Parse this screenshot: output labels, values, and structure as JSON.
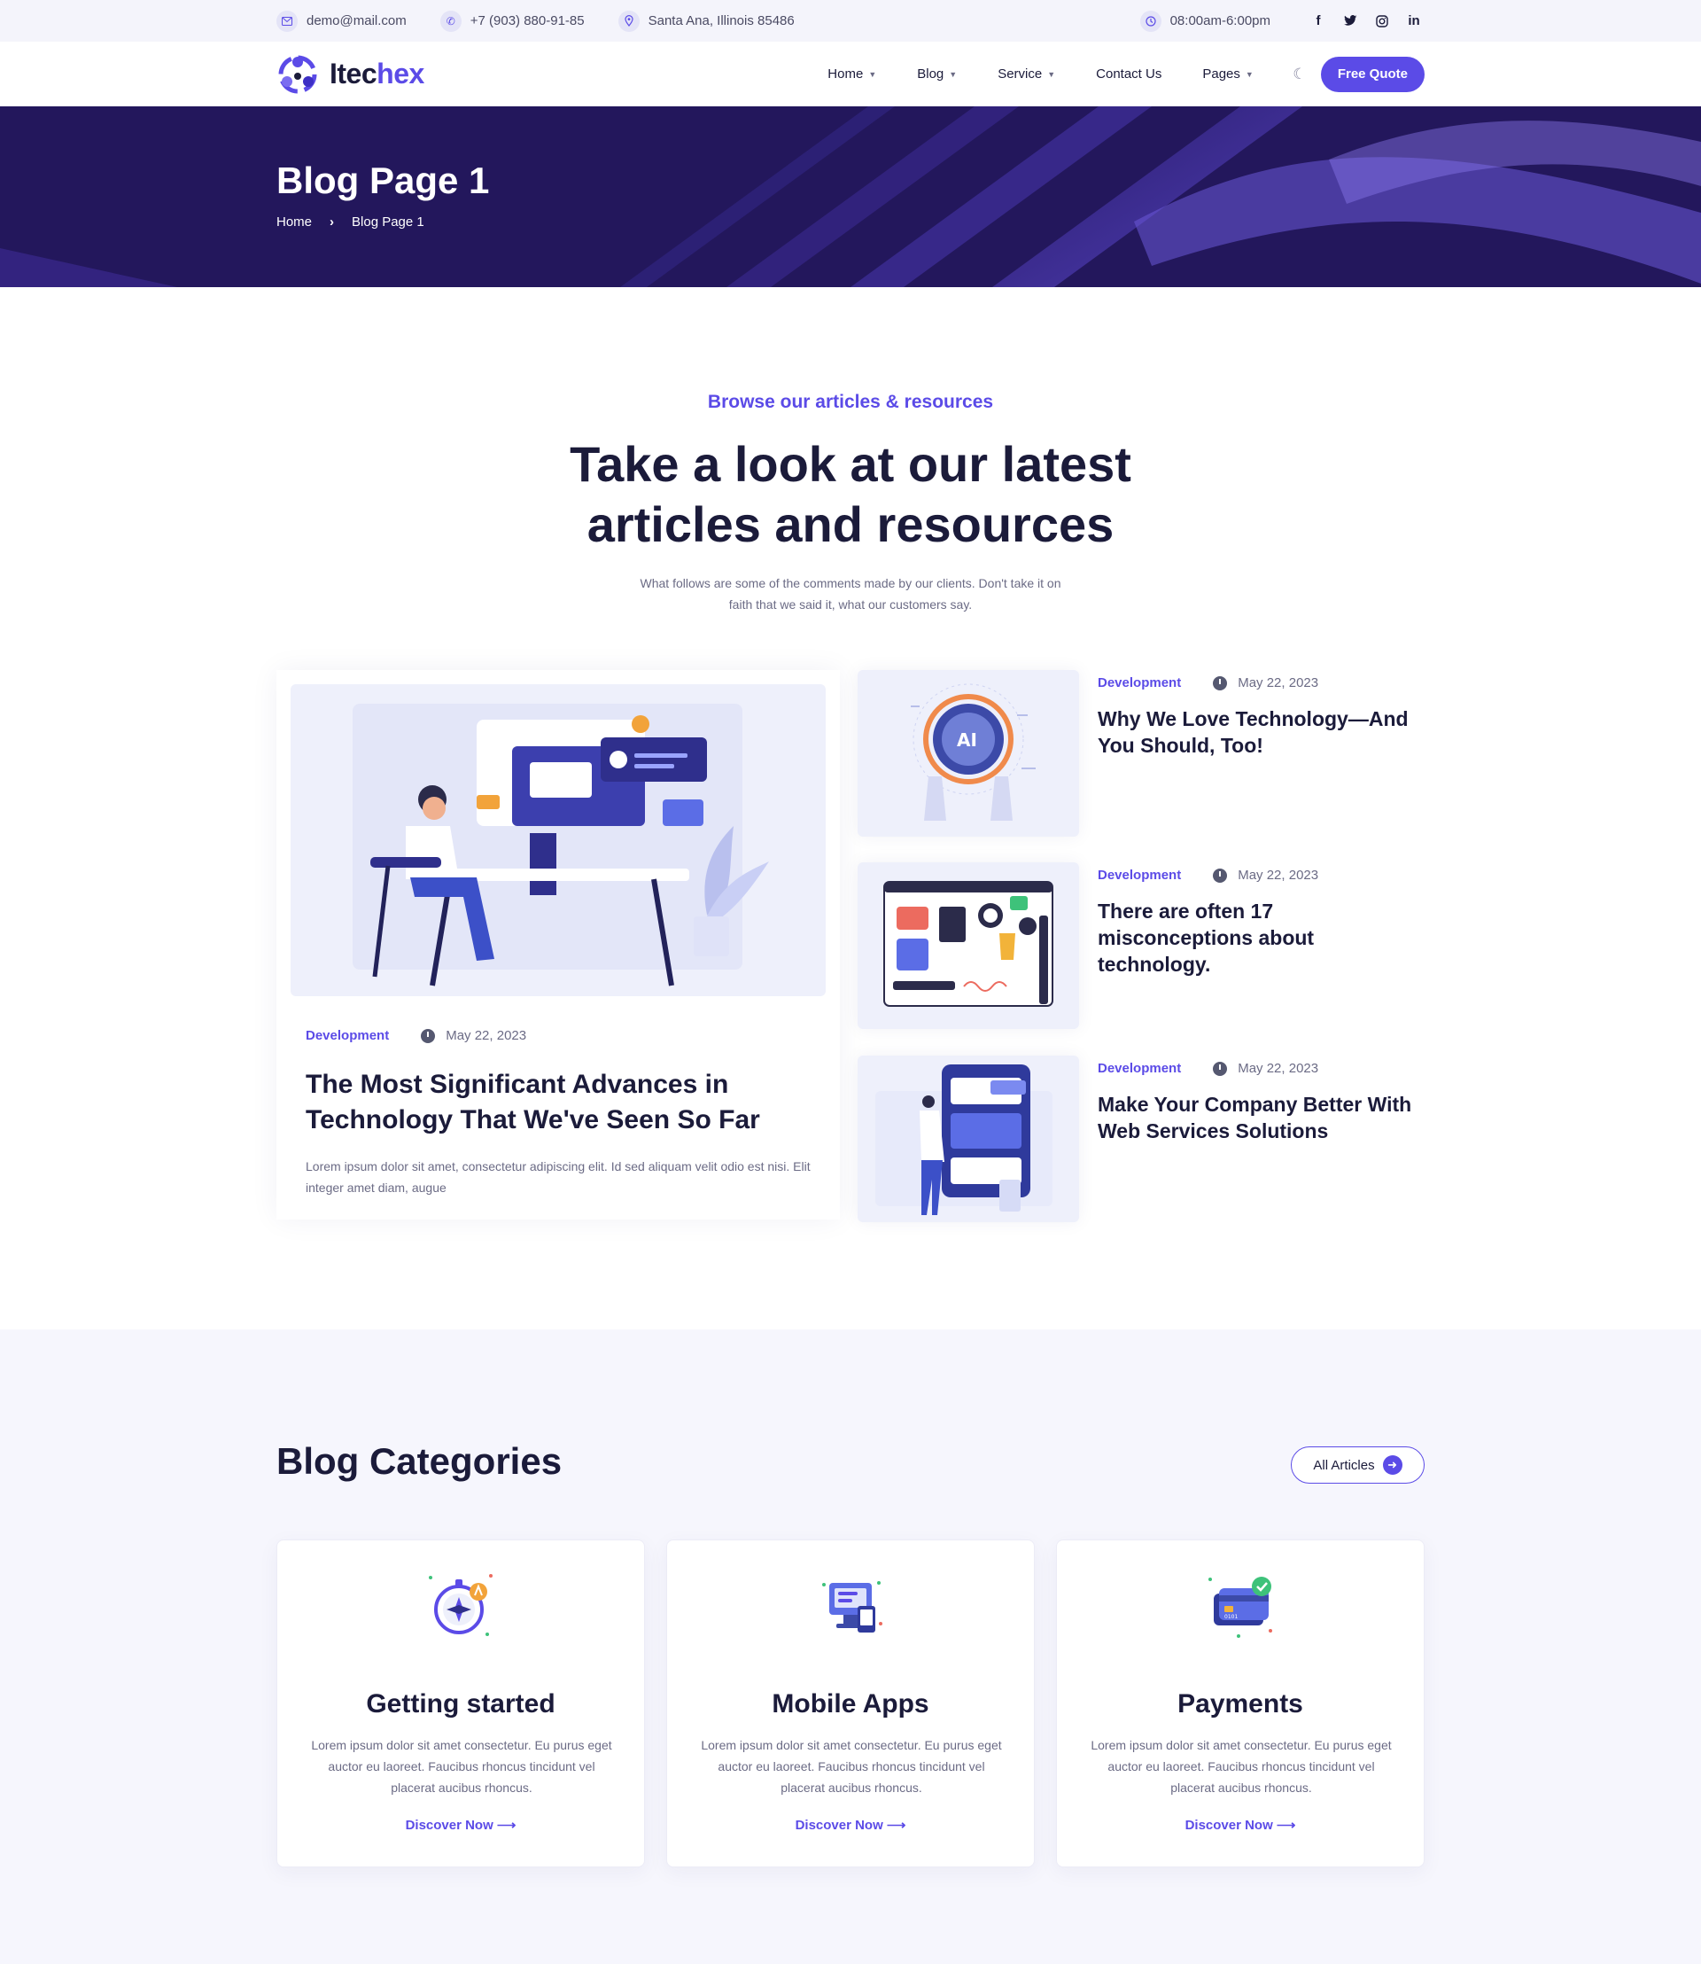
{
  "topbar": {
    "email": "demo@mail.com",
    "phone": "+7 (903) 880-91-85",
    "address": "Santa Ana, Illinois 85486",
    "hours": "08:00am-6:00pm",
    "social_icons": [
      "facebook-icon",
      "twitter-icon",
      "instagram-icon",
      "linkedin-icon"
    ]
  },
  "header": {
    "logo_prefix": "Itec",
    "logo_suffix": "hex",
    "nav": [
      {
        "label": "Home"
      },
      {
        "label": "Blog"
      },
      {
        "label": "Service"
      },
      {
        "label": "Contact Us"
      },
      {
        "label": "Pages"
      }
    ],
    "quote_label": "Free Quote"
  },
  "banner": {
    "title": "Blog Page 1",
    "crumb_home": "Home",
    "crumb_current": "Blog Page 1"
  },
  "articles": {
    "subtitle": "Browse our articles & resources",
    "title": "Take a look at our latest articles and resources",
    "description": "What follows are some of the comments made by our clients. Don't take it on faith that we said it, what our customers say.",
    "featured": {
      "category": "Development",
      "date": "May 22, 2023",
      "title": "The Most Significant Advances in Technology That We've Seen So Far",
      "excerpt": "Lorem ipsum dolor sit amet, consectetur adipiscing elit. Id sed aliquam velit odio est nisi. Elit integer amet diam, augue"
    },
    "side": [
      {
        "category": "Development",
        "date": "May 22, 2023",
        "title": "Why We Love Technology—And You Should, Too!"
      },
      {
        "category": "Development",
        "date": "May 22, 2023",
        "title": "There are often 17 misconceptions about technology."
      },
      {
        "category": "Development",
        "date": "May 22, 2023",
        "title": "Make Your Company Better With Web Services Solutions"
      }
    ]
  },
  "categories": {
    "heading": "Blog Categories",
    "all_label": "All Articles",
    "cards": [
      {
        "title": "Getting started",
        "desc": "Lorem ipsum dolor sit amet consectetur. Eu purus eget auctor eu laoreet. Faucibus rhoncus tincidunt vel placerat aucibus rhoncus.",
        "link": "Discover Now ⟶",
        "icon": "compass-icon"
      },
      {
        "title": "Mobile Apps",
        "desc": "Lorem ipsum dolor sit amet consectetur. Eu purus eget auctor eu laoreet. Faucibus rhoncus tincidunt vel placerat aucibus rhoncus.",
        "link": "Discover Now ⟶",
        "icon": "devices-icon"
      },
      {
        "title": "Payments",
        "desc": "Lorem ipsum dolor sit amet consectetur. Eu purus eget auctor eu laoreet. Faucibus rhoncus tincidunt vel placerat aucibus rhoncus.",
        "link": "Discover Now ⟶",
        "icon": "credit-card-icon"
      }
    ]
  },
  "colors": {
    "accent": "#5b4be7",
    "banner_bg": "#23175c",
    "text_dark": "#1b1b3a"
  }
}
